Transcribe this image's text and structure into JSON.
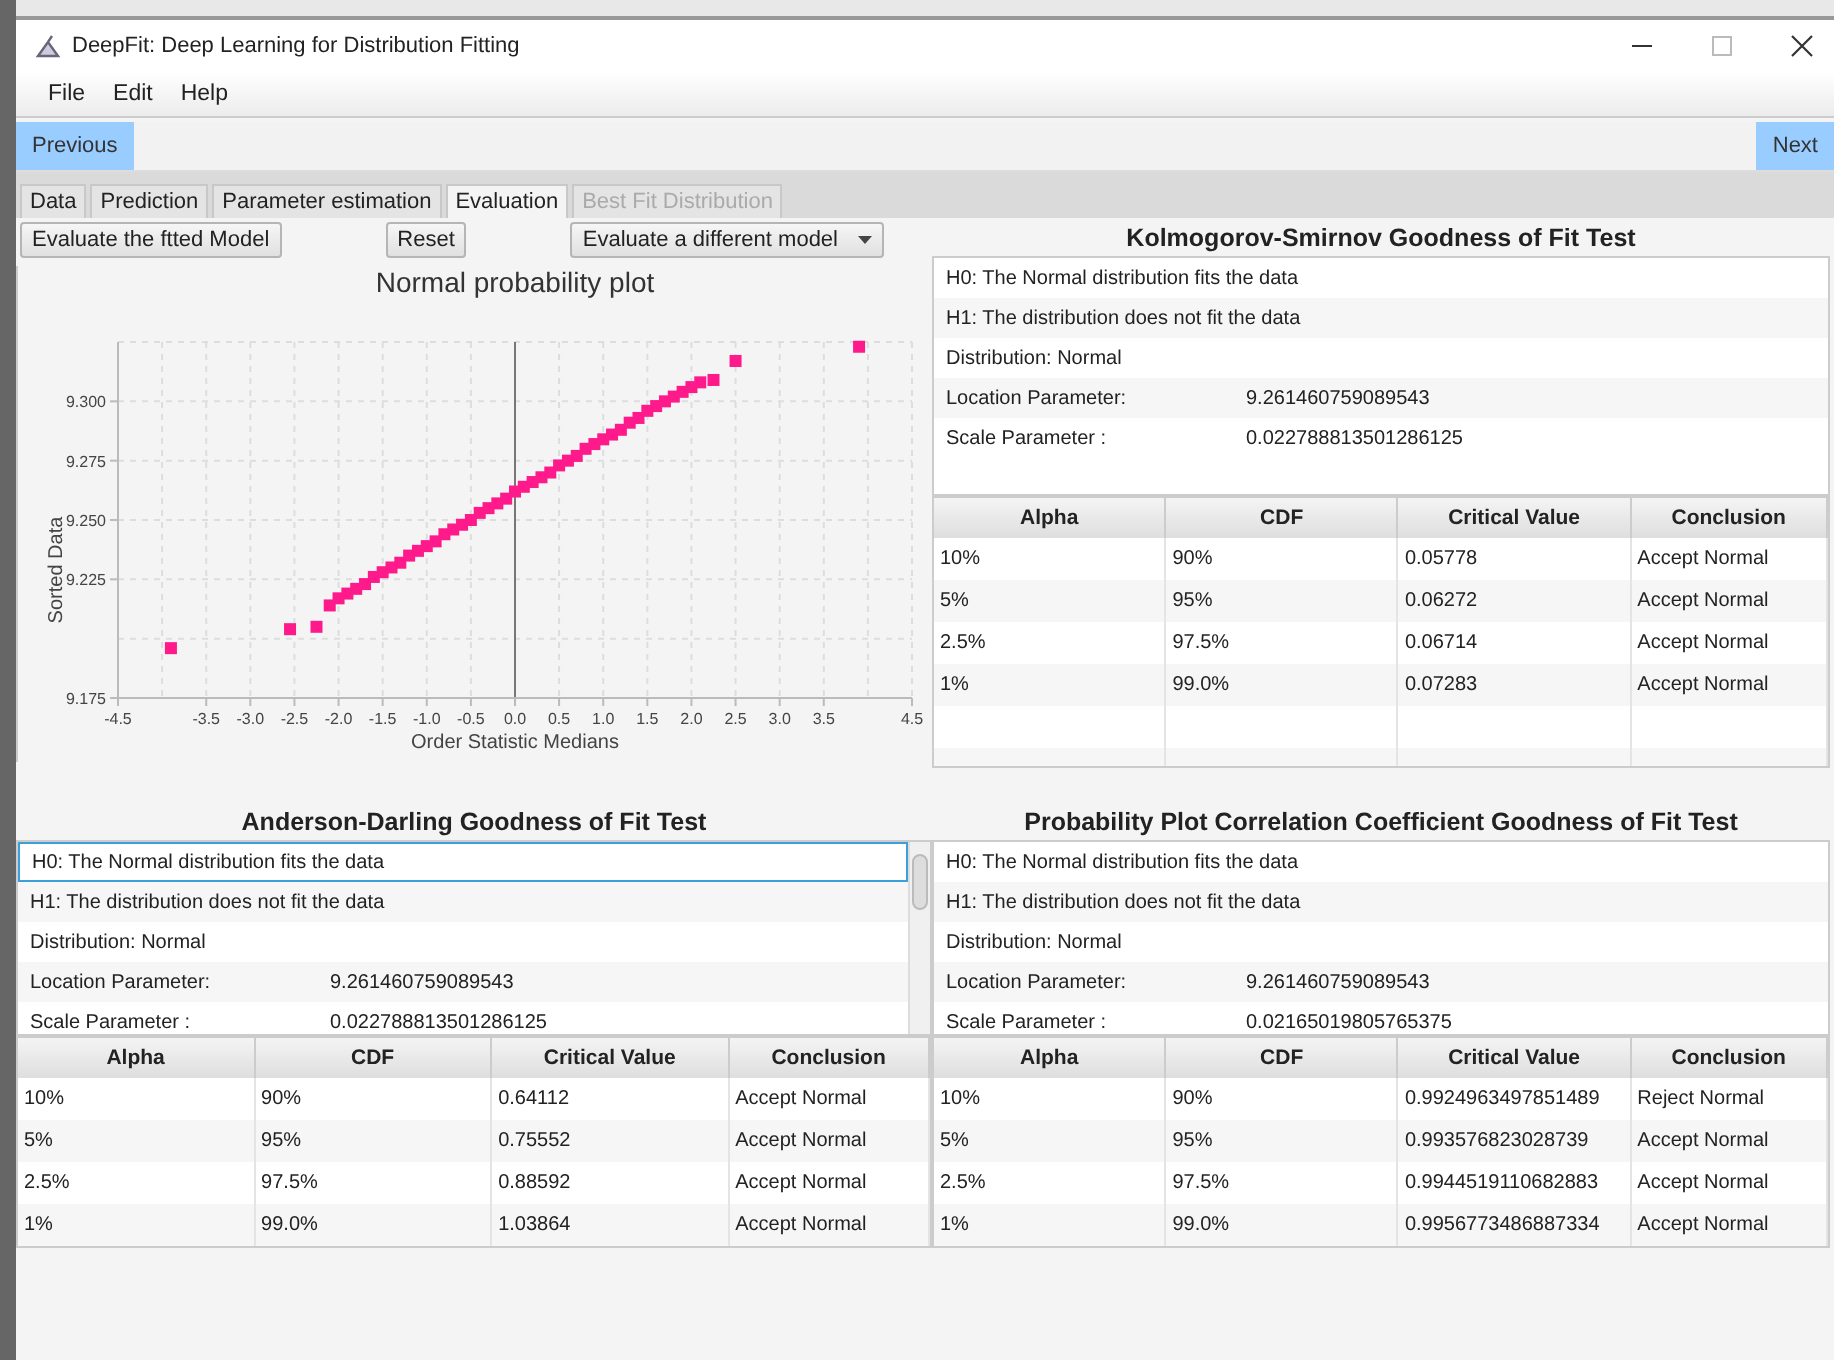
{
  "window": {
    "title": "DeepFit: Deep Learning for Distribution Fitting"
  },
  "menu": [
    "File",
    "Edit",
    "Help"
  ],
  "nav": {
    "previous": "Previous",
    "next": "Next"
  },
  "tabs": [
    {
      "label": "Data",
      "selected": false,
      "disabled": false
    },
    {
      "label": "Prediction",
      "selected": false,
      "disabled": false
    },
    {
      "label": "Parameter estimation",
      "selected": false,
      "disabled": false
    },
    {
      "label": "Evaluation",
      "selected": true,
      "disabled": false
    },
    {
      "label": "Best Fit Distribution",
      "selected": false,
      "disabled": true
    }
  ],
  "toolbar": {
    "evaluate": "Evaluate the ftted Model",
    "reset": "Reset",
    "model_dropdown": "Evaluate a different model"
  },
  "plot": {
    "chart_data": {
      "type": "scatter",
      "title": "Normal probability plot",
      "xlabel": "Order Statistic Medians",
      "ylabel": "Sorted Data",
      "xlim": [
        -4.5,
        4.5
      ],
      "ylim": [
        9.175,
        9.325
      ],
      "grid": true,
      "xticks": [
        {
          "value": -4.5,
          "label": "-4.5"
        },
        {
          "value": -3.5,
          "label": "-3.5"
        },
        {
          "value": -3,
          "label": "-3.0"
        },
        {
          "value": -2.5,
          "label": "-2.5"
        },
        {
          "value": -2,
          "label": "-2.0"
        },
        {
          "value": -1.5,
          "label": "-1.5"
        },
        {
          "value": -1,
          "label": "-1.0"
        },
        {
          "value": -0.5,
          "label": "-0.5"
        },
        {
          "value": 0,
          "label": "0.0"
        },
        {
          "value": 0.5,
          "label": "0.5"
        },
        {
          "value": 1,
          "label": "1.0"
        },
        {
          "value": 1.5,
          "label": "1.5"
        },
        {
          "value": 2,
          "label": "2.0"
        },
        {
          "value": 2.5,
          "label": "2.5"
        },
        {
          "value": 3,
          "label": "3.0"
        },
        {
          "value": 3.5,
          "label": "3.5"
        },
        {
          "value": 4.5,
          "label": "4.5"
        }
      ],
      "yticks": [
        {
          "value": 9.175,
          "label": "9.175"
        },
        {
          "value": 9.225,
          "label": "9.225"
        },
        {
          "value": 9.25,
          "label": "9.250"
        },
        {
          "value": 9.275,
          "label": "9.275"
        },
        {
          "value": 9.3,
          "label": "9.300"
        }
      ],
      "x": [
        -3.9,
        -2.55,
        -2.25,
        -2.1,
        -2.0,
        -1.9,
        -1.8,
        -1.7,
        -1.6,
        -1.5,
        -1.4,
        -1.3,
        -1.2,
        -1.1,
        -1.0,
        -0.9,
        -0.8,
        -0.7,
        -0.6,
        -0.5,
        -0.4,
        -0.3,
        -0.2,
        -0.1,
        0.0,
        0.1,
        0.2,
        0.3,
        0.4,
        0.5,
        0.6,
        0.7,
        0.8,
        0.9,
        1.0,
        1.1,
        1.2,
        1.3,
        1.4,
        1.5,
        1.6,
        1.7,
        1.8,
        1.9,
        2.0,
        2.1,
        2.25,
        2.5,
        3.9
      ],
      "series": [
        {
          "color": "#ff1a8c",
          "values": [
            9.196,
            9.204,
            9.205,
            9.214,
            9.217,
            9.219,
            9.221,
            9.223,
            9.226,
            9.228,
            9.23,
            9.232,
            9.235,
            9.237,
            9.239,
            9.241,
            9.244,
            9.246,
            9.248,
            9.25,
            9.253,
            9.255,
            9.257,
            9.259,
            9.262,
            9.264,
            9.266,
            9.268,
            9.27,
            9.273,
            9.275,
            9.277,
            9.28,
            9.282,
            9.284,
            9.286,
            9.288,
            9.291,
            9.293,
            9.296,
            9.298,
            9.3,
            9.302,
            9.304,
            9.306,
            9.308,
            9.309,
            9.317,
            9.323
          ]
        }
      ]
    }
  },
  "tests": [
    {
      "title": "Kolmogorov-Smirnov Goodness of Fit Test",
      "scrollbar": false,
      "info": [
        {
          "label": "H0: The Normal distribution fits the data",
          "selected": false
        },
        {
          "label": "H1: The distribution does not fit the data",
          "selected": false
        },
        {
          "label": "Distribution: Normal",
          "selected": false
        },
        {
          "label": "Location Parameter:",
          "value": "9.261460759089543",
          "selected": false
        },
        {
          "label": "Scale Parameter :",
          "value": "0.022788813501286125",
          "selected": false
        }
      ],
      "columns": [
        "Alpha",
        "CDF",
        "Critical Value",
        "Conclusion"
      ],
      "rows": [
        [
          "10%",
          "90%",
          "0.05778",
          "Accept Normal"
        ],
        [
          "5%",
          "95%",
          "0.06272",
          "Accept Normal"
        ],
        [
          "2.5%",
          "97.5%",
          "0.06714",
          "Accept Normal"
        ],
        [
          "1%",
          "99.0%",
          "0.07283",
          "Accept Normal"
        ]
      ]
    },
    {
      "title": "Anderson-Darling Goodness of Fit Test",
      "scrollbar": true,
      "info": [
        {
          "label": "H0: The Normal distribution fits the data",
          "selected": true
        },
        {
          "label": "H1: The distribution does not fit the data",
          "selected": false
        },
        {
          "label": "Distribution: Normal",
          "selected": false
        },
        {
          "label": "Location Parameter:",
          "value": "9.261460759089543",
          "selected": false
        },
        {
          "label": "Scale Parameter :",
          "value": "0.022788813501286125",
          "selected": false
        }
      ],
      "columns": [
        "Alpha",
        "CDF",
        "Critical Value",
        "Conclusion"
      ],
      "rows": [
        [
          "10%",
          "90%",
          "0.64112",
          "Accept Normal"
        ],
        [
          "5%",
          "95%",
          "0.75552",
          "Accept Normal"
        ],
        [
          "2.5%",
          "97.5%",
          "0.88592",
          "Accept Normal"
        ],
        [
          "1%",
          "99.0%",
          "1.03864",
          "Accept Normal"
        ]
      ]
    },
    {
      "title": "Probability Plot Correlation Coefficient Goodness of Fit Test",
      "scrollbar": false,
      "info": [
        {
          "label": "H0: The Normal distribution fits the data",
          "selected": false
        },
        {
          "label": "H1: The distribution does not fit the data",
          "selected": false
        },
        {
          "label": "Distribution: Normal",
          "selected": false
        },
        {
          "label": "Location Parameter:",
          "value": "9.261460759089543",
          "selected": false
        },
        {
          "label": "Scale Parameter :",
          "value": "0.02165019805765375",
          "selected": false
        }
      ],
      "columns": [
        "Alpha",
        "CDF",
        "Critical Value",
        "Conclusion"
      ],
      "rows": [
        [
          "10%",
          "90%",
          "0.9924963497851489",
          "Reject Normal"
        ],
        [
          "5%",
          "95%",
          "0.993576823028739",
          "Accept Normal"
        ],
        [
          "2.5%",
          "97.5%",
          "0.9944519110682883",
          "Accept Normal"
        ],
        [
          "1%",
          "99.0%",
          "0.9956773486887334",
          "Accept Normal"
        ]
      ]
    }
  ]
}
